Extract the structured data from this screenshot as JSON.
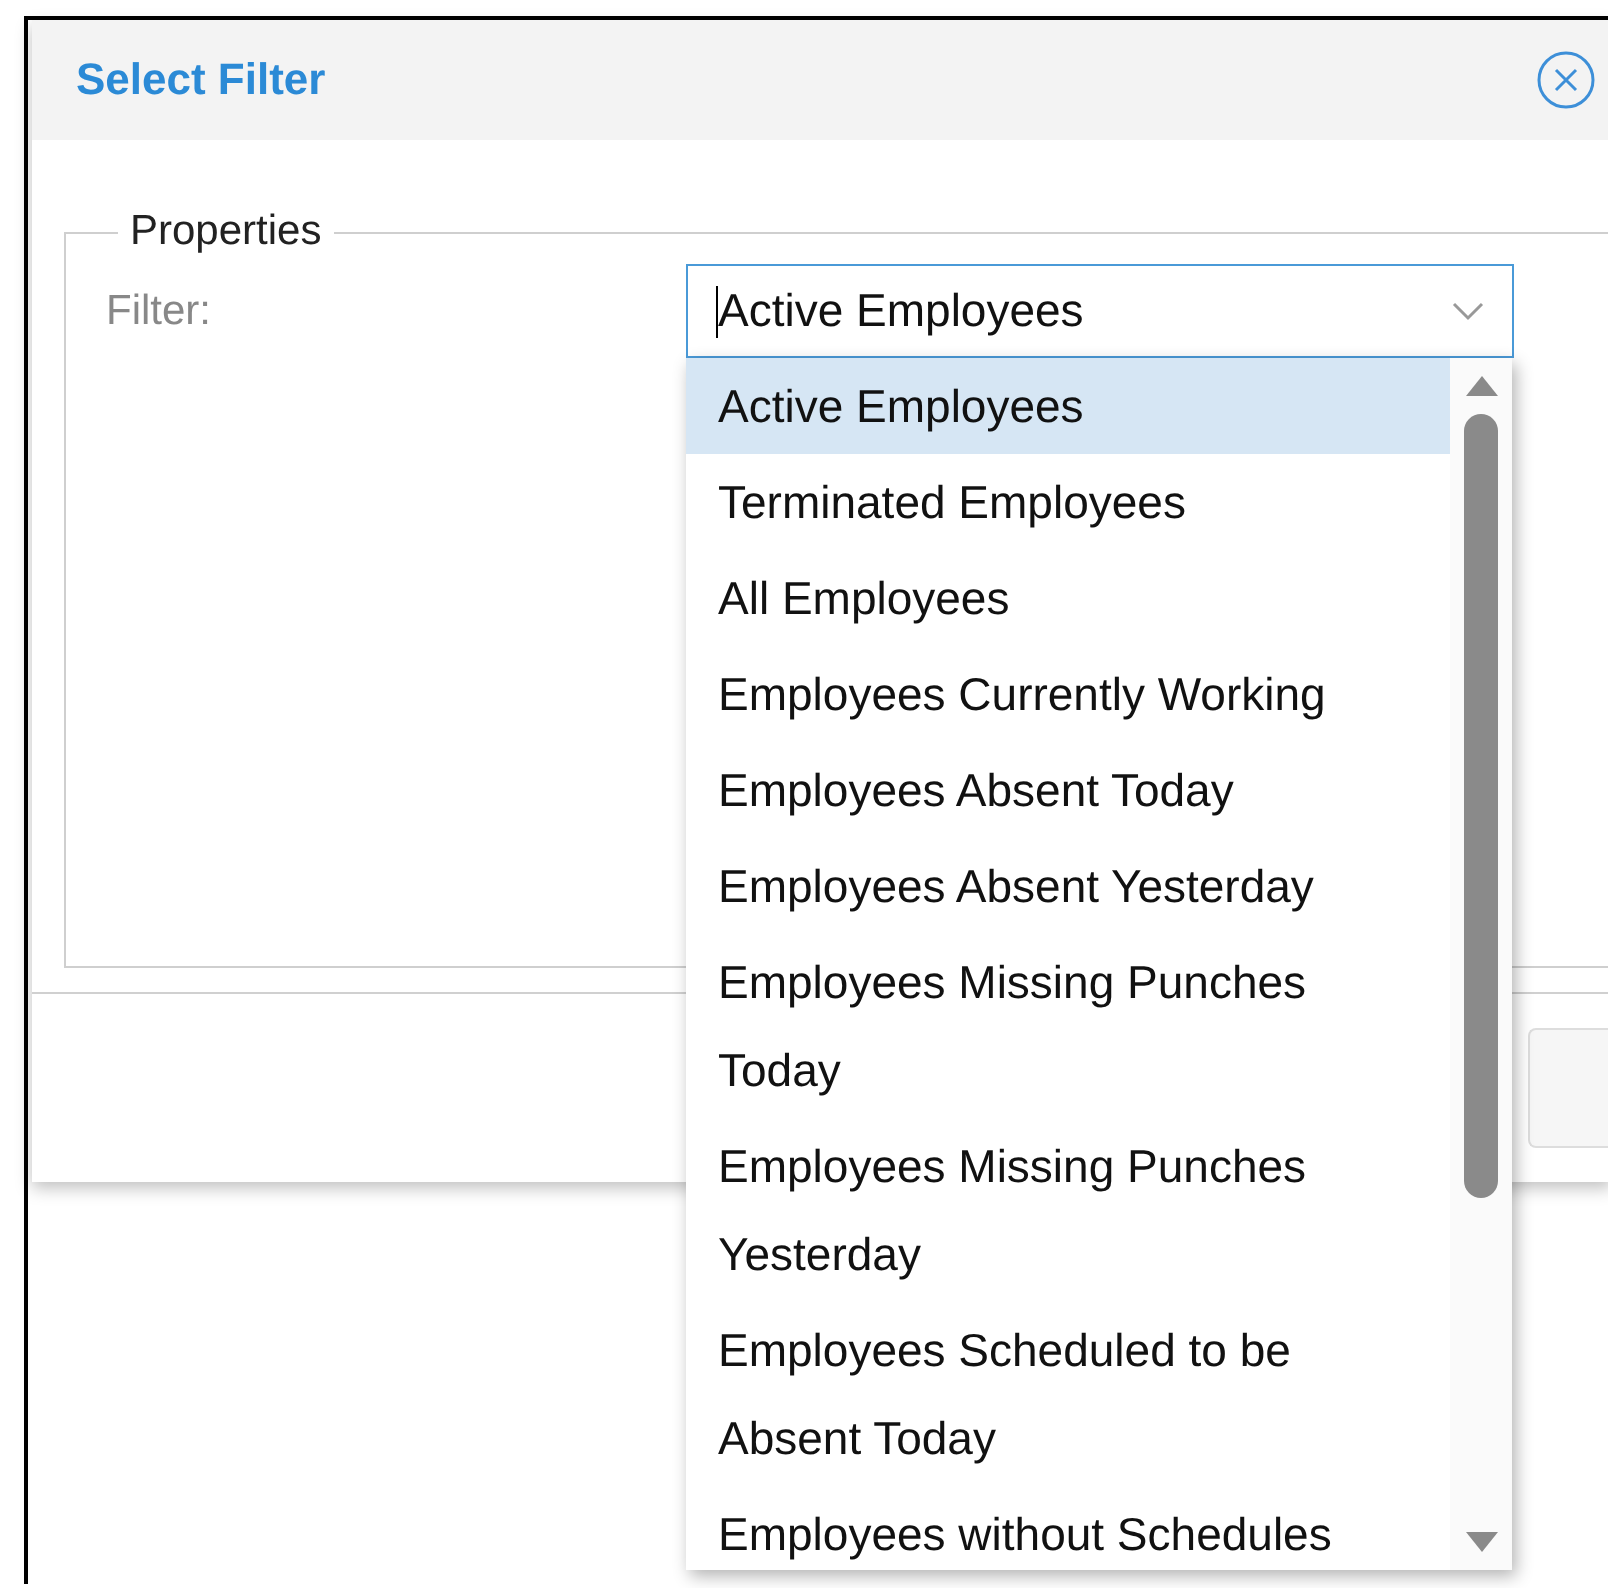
{
  "dialog": {
    "title": "Select Filter"
  },
  "properties": {
    "legend": "Properties",
    "filter_label": "Filter:",
    "filter_value": "Active Employees"
  },
  "dropdown": {
    "expanded": true,
    "options": [
      {
        "label": "Active Employees",
        "selected": true
      },
      {
        "label": "Terminated Employees",
        "selected": false
      },
      {
        "label": "All Employees",
        "selected": false
      },
      {
        "label": "Employees Currently Working",
        "selected": false
      },
      {
        "label": "Employees Absent Today",
        "selected": false
      },
      {
        "label": "Employees Absent Yesterday",
        "selected": false
      },
      {
        "label": "Employees Missing Punches Today",
        "selected": false
      },
      {
        "label": "Employees Missing Punches Yesterday",
        "selected": false
      },
      {
        "label": "Employees Scheduled to be Absent Today",
        "selected": false
      },
      {
        "label": "Employees without Schedules",
        "selected": false
      }
    ]
  }
}
